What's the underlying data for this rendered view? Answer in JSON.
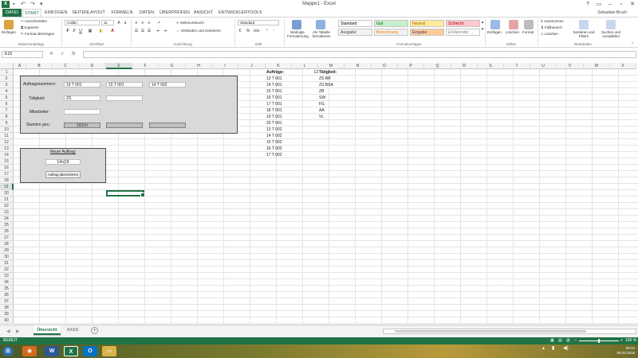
{
  "window": {
    "title": "Mappe1 - Excel",
    "user": "Sebastian Bruch",
    "help": "?"
  },
  "ribbon_tabs": [
    {
      "label": "DATEI"
    },
    {
      "label": "START"
    },
    {
      "label": "EINFÜGEN"
    },
    {
      "label": "SEITENLAYOUT"
    },
    {
      "label": "FORMELN"
    },
    {
      "label": "DATEN"
    },
    {
      "label": "ÜBERPRÜFEN"
    },
    {
      "label": "ANSICHT"
    },
    {
      "label": "ENTWICKLERTOOLS"
    }
  ],
  "ribbon": {
    "clipboard": {
      "paste": "Einfügen",
      "cut": "Ausschneiden",
      "copy": "Kopieren",
      "format_painter": "Format übertragen",
      "label": "Zwischenablage"
    },
    "font": {
      "name": "Calibri",
      "size": "11",
      "label": "Schriftart",
      "bold": "F",
      "italic": "K",
      "underline": "U"
    },
    "alignment": {
      "wrap": "Zeilenumbruch",
      "merge": "Verbinden und zentrieren",
      "label": "Ausrichtung"
    },
    "number": {
      "format": "Standard",
      "label": "Zahl",
      "percent": "%",
      "thousands": "000"
    },
    "styles": {
      "conditional": "Bedingte Formatierung",
      "as_table": "Als Tabelle formatieren",
      "label": "Formatvorlagen",
      "cells": [
        {
          "label": "Standard",
          "bg": "#ffffff",
          "fg": "#000000"
        },
        {
          "label": "Gut",
          "bg": "#c6efce",
          "fg": "#006100"
        },
        {
          "label": "Neutral",
          "bg": "#ffeb9c",
          "fg": "#9c6500"
        },
        {
          "label": "Schlecht",
          "bg": "#ffc7ce",
          "fg": "#9c0006"
        },
        {
          "label": "Ausgabe",
          "bg": "#f2f2f2",
          "fg": "#3f3f3f"
        },
        {
          "label": "Berechnung",
          "bg": "#f2f2f2",
          "fg": "#fa7d00"
        },
        {
          "label": "Eingabe",
          "bg": "#ffcc99",
          "fg": "#3f3f76"
        },
        {
          "label": "Erklärender ...",
          "bg": "#ffffff",
          "fg": "#7f7f7f"
        }
      ]
    },
    "cells": {
      "insert": "Einfügen",
      "delete": "Löschen",
      "format": "Format",
      "label": "Zellen"
    },
    "editing": {
      "autosum": "AutoSumme",
      "fill": "Füllbereich",
      "clear": "Löschen",
      "sort": "Sortieren und Filtern",
      "find": "Suchen und Auswählen",
      "label": "Bearbeiten"
    }
  },
  "formula_bar": {
    "name_box": "E19",
    "value": "",
    "cancel": "✕",
    "enter": "✓",
    "fx": "fx"
  },
  "columns": [
    "A",
    "B",
    "C",
    "D",
    "E",
    "F",
    "G",
    "H",
    "I",
    "J",
    "K",
    "L",
    "M",
    "N",
    "O",
    "P",
    "Q",
    "R",
    "S",
    "T",
    "U",
    "V",
    "W",
    "X"
  ],
  "rows": [
    "1",
    "2",
    "3",
    "4",
    "5",
    "6",
    "7",
    "8",
    "9",
    "10",
    "11",
    "12",
    "13",
    "14",
    "15",
    "16",
    "17",
    "18",
    "19",
    "20",
    "21",
    "22",
    "23",
    "24",
    "25",
    "26",
    "27",
    "28",
    "29",
    "30",
    "31",
    "32",
    "33",
    "34",
    "35",
    "36",
    "37",
    "38",
    "39",
    "40"
  ],
  "form": {
    "auftragsnummern_label": "Auftragsnummern:",
    "auftragsnummern": [
      "19 T 001",
      "15 T 001",
      "14 T 002"
    ],
    "taetigkeit_label": "Tätigkeit:",
    "taetigkeit_value": "ZS",
    "mitarbeiter_label": "Mitarbeiter:",
    "mitarbeiter_value": "",
    "stunden_label": "Stunden ges.:",
    "stunden_value": "19,0 h"
  },
  "new_order": {
    "title": "Neuer Auftrag:",
    "value": "14n|18",
    "button": "Auftrag übernehmen"
  },
  "orders": {
    "header": "Aufträge:",
    "count": "13",
    "list": [
      "13 T 001",
      "14 T 001",
      "15 T 001",
      "16 T 001",
      "17 T 001",
      "18 T 001",
      "19 T 001",
      "20 T 001",
      "13 T 002",
      "14 T 002",
      "15 T 002",
      "16 T 002",
      "17 T 002"
    ]
  },
  "activities": {
    "header": "Tätigkeit:",
    "list": [
      "ZS BR",
      "ZS BSA",
      "ZB",
      "SW",
      "FG",
      "AA",
      "VL"
    ]
  },
  "sheet_tabs": [
    {
      "label": "Übersicht"
    },
    {
      "label": "XXXX"
    }
  ],
  "status": {
    "ready": "BEREIT",
    "zoom": "100 %"
  },
  "clock": {
    "time": "08:44",
    "date": "06.03.2015"
  }
}
